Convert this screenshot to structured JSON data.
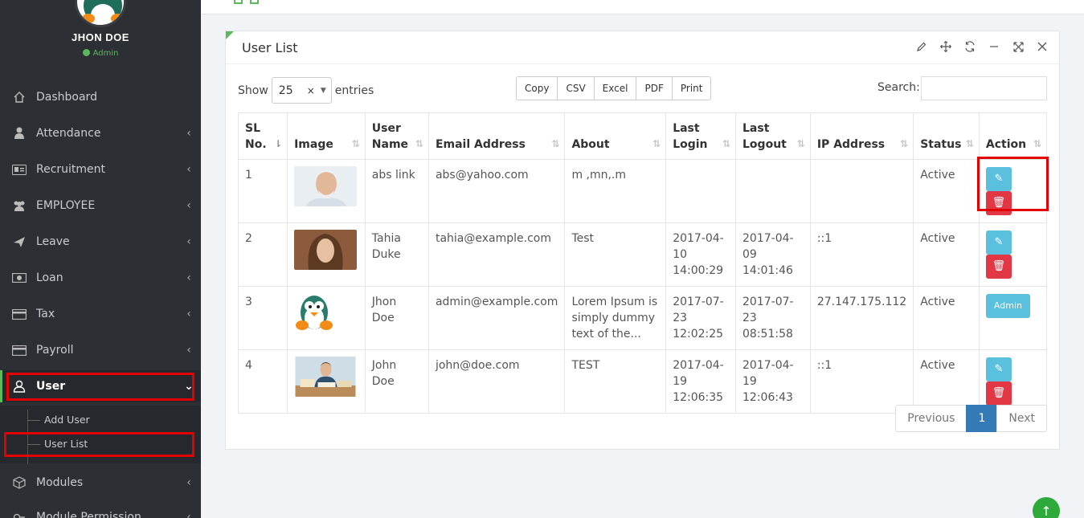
{
  "user": {
    "name": "JHON DOE",
    "role": "Admin"
  },
  "sidebar": {
    "items": [
      {
        "label": "Dashboard",
        "icon": "home-icon",
        "has_chevron": false
      },
      {
        "label": "Attendance",
        "icon": "user-icon",
        "has_chevron": true
      },
      {
        "label": "Recruitment",
        "icon": "id-card-icon",
        "has_chevron": true
      },
      {
        "label": "EMPLOYEE",
        "icon": "users-icon",
        "has_chevron": true
      },
      {
        "label": "Leave",
        "icon": "plane-icon",
        "has_chevron": true
      },
      {
        "label": "Loan",
        "icon": "money-icon",
        "has_chevron": true
      },
      {
        "label": "Tax",
        "icon": "credit-card-icon",
        "has_chevron": true
      },
      {
        "label": "Payroll",
        "icon": "credit-card-icon",
        "has_chevron": true
      },
      {
        "label": "User",
        "icon": "user-outline-icon",
        "has_chevron": true
      },
      {
        "label": "Modules",
        "icon": "cube-icon",
        "has_chevron": true
      },
      {
        "label": "Module Permission",
        "icon": "key-icon",
        "has_chevron": true
      }
    ],
    "submenu": [
      "Add User",
      "User List"
    ]
  },
  "panel": {
    "title": "User List",
    "show_label": "Show",
    "entries_value": "25",
    "entries_label": "entries",
    "export_buttons": [
      "Copy",
      "CSV",
      "Excel",
      "PDF",
      "Print"
    ],
    "search_label": "Search:",
    "search_value": ""
  },
  "table": {
    "headers": [
      "SL No.",
      "Image",
      "User Name",
      "Email Address",
      "About",
      "Last Login",
      "Last Logout",
      "IP Address",
      "Status",
      "Action"
    ],
    "rows": [
      {
        "sl": "1",
        "image": "old-man-photo",
        "name": "abs link",
        "email": "abs@yahoo.com",
        "about": "m ,mn,.m",
        "last_login": "",
        "last_logout": "",
        "ip": "",
        "status": "Active",
        "action": "edit-delete"
      },
      {
        "sl": "2",
        "image": "woman-photo",
        "name": "Tahia Duke",
        "email": "tahia@example.com",
        "about": "Test",
        "last_login": "2017-04-10 14:00:29",
        "last_logout": "2017-04-09 14:01:46",
        "ip": "::1",
        "status": "Active",
        "action": "edit-delete"
      },
      {
        "sl": "3",
        "image": "penguin-avatar",
        "name": "Jhon Doe",
        "email": "admin@example.com",
        "about": "Lorem Ipsum is simply dummy text of the...",
        "last_login": "2017-07-23 12:02:25",
        "last_logout": "2017-07-23 08:51:58",
        "ip": "27.147.175.112",
        "status": "Active",
        "action": "Admin"
      },
      {
        "sl": "4",
        "image": "man-reading-photo",
        "name": "John Doe",
        "email": "john@doe.com",
        "about": "TEST",
        "last_login": "2017-04-19 12:06:35",
        "last_logout": "2017-04-19 12:06:43",
        "ip": "::1",
        "status": "Active",
        "action": "edit-delete"
      }
    ]
  },
  "pagination": {
    "previous": "Previous",
    "current": "1",
    "next": "Next"
  },
  "colors": {
    "sidebar_bg": "#2c2f33",
    "accent_green": "#5cb85c",
    "highlight_red": "#e30000",
    "edit_blue": "#5bc0de",
    "delete_red": "#e23845",
    "page_blue": "#337ab7"
  }
}
